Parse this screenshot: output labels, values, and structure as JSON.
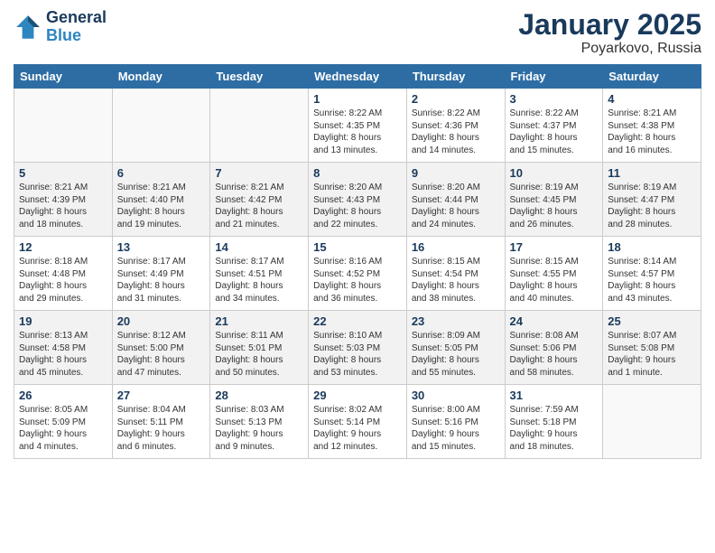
{
  "header": {
    "logo_line1": "General",
    "logo_line2": "Blue",
    "month_title": "January 2025",
    "location": "Poyarkovo, Russia"
  },
  "weekdays": [
    "Sunday",
    "Monday",
    "Tuesday",
    "Wednesday",
    "Thursday",
    "Friday",
    "Saturday"
  ],
  "weeks": [
    [
      {
        "day": "",
        "info": ""
      },
      {
        "day": "",
        "info": ""
      },
      {
        "day": "",
        "info": ""
      },
      {
        "day": "1",
        "info": "Sunrise: 8:22 AM\nSunset: 4:35 PM\nDaylight: 8 hours\nand 13 minutes."
      },
      {
        "day": "2",
        "info": "Sunrise: 8:22 AM\nSunset: 4:36 PM\nDaylight: 8 hours\nand 14 minutes."
      },
      {
        "day": "3",
        "info": "Sunrise: 8:22 AM\nSunset: 4:37 PM\nDaylight: 8 hours\nand 15 minutes."
      },
      {
        "day": "4",
        "info": "Sunrise: 8:21 AM\nSunset: 4:38 PM\nDaylight: 8 hours\nand 16 minutes."
      }
    ],
    [
      {
        "day": "5",
        "info": "Sunrise: 8:21 AM\nSunset: 4:39 PM\nDaylight: 8 hours\nand 18 minutes."
      },
      {
        "day": "6",
        "info": "Sunrise: 8:21 AM\nSunset: 4:40 PM\nDaylight: 8 hours\nand 19 minutes."
      },
      {
        "day": "7",
        "info": "Sunrise: 8:21 AM\nSunset: 4:42 PM\nDaylight: 8 hours\nand 21 minutes."
      },
      {
        "day": "8",
        "info": "Sunrise: 8:20 AM\nSunset: 4:43 PM\nDaylight: 8 hours\nand 22 minutes."
      },
      {
        "day": "9",
        "info": "Sunrise: 8:20 AM\nSunset: 4:44 PM\nDaylight: 8 hours\nand 24 minutes."
      },
      {
        "day": "10",
        "info": "Sunrise: 8:19 AM\nSunset: 4:45 PM\nDaylight: 8 hours\nand 26 minutes."
      },
      {
        "day": "11",
        "info": "Sunrise: 8:19 AM\nSunset: 4:47 PM\nDaylight: 8 hours\nand 28 minutes."
      }
    ],
    [
      {
        "day": "12",
        "info": "Sunrise: 8:18 AM\nSunset: 4:48 PM\nDaylight: 8 hours\nand 29 minutes."
      },
      {
        "day": "13",
        "info": "Sunrise: 8:17 AM\nSunset: 4:49 PM\nDaylight: 8 hours\nand 31 minutes."
      },
      {
        "day": "14",
        "info": "Sunrise: 8:17 AM\nSunset: 4:51 PM\nDaylight: 8 hours\nand 34 minutes."
      },
      {
        "day": "15",
        "info": "Sunrise: 8:16 AM\nSunset: 4:52 PM\nDaylight: 8 hours\nand 36 minutes."
      },
      {
        "day": "16",
        "info": "Sunrise: 8:15 AM\nSunset: 4:54 PM\nDaylight: 8 hours\nand 38 minutes."
      },
      {
        "day": "17",
        "info": "Sunrise: 8:15 AM\nSunset: 4:55 PM\nDaylight: 8 hours\nand 40 minutes."
      },
      {
        "day": "18",
        "info": "Sunrise: 8:14 AM\nSunset: 4:57 PM\nDaylight: 8 hours\nand 43 minutes."
      }
    ],
    [
      {
        "day": "19",
        "info": "Sunrise: 8:13 AM\nSunset: 4:58 PM\nDaylight: 8 hours\nand 45 minutes."
      },
      {
        "day": "20",
        "info": "Sunrise: 8:12 AM\nSunset: 5:00 PM\nDaylight: 8 hours\nand 47 minutes."
      },
      {
        "day": "21",
        "info": "Sunrise: 8:11 AM\nSunset: 5:01 PM\nDaylight: 8 hours\nand 50 minutes."
      },
      {
        "day": "22",
        "info": "Sunrise: 8:10 AM\nSunset: 5:03 PM\nDaylight: 8 hours\nand 53 minutes."
      },
      {
        "day": "23",
        "info": "Sunrise: 8:09 AM\nSunset: 5:05 PM\nDaylight: 8 hours\nand 55 minutes."
      },
      {
        "day": "24",
        "info": "Sunrise: 8:08 AM\nSunset: 5:06 PM\nDaylight: 8 hours\nand 58 minutes."
      },
      {
        "day": "25",
        "info": "Sunrise: 8:07 AM\nSunset: 5:08 PM\nDaylight: 9 hours\nand 1 minute."
      }
    ],
    [
      {
        "day": "26",
        "info": "Sunrise: 8:05 AM\nSunset: 5:09 PM\nDaylight: 9 hours\nand 4 minutes."
      },
      {
        "day": "27",
        "info": "Sunrise: 8:04 AM\nSunset: 5:11 PM\nDaylight: 9 hours\nand 6 minutes."
      },
      {
        "day": "28",
        "info": "Sunrise: 8:03 AM\nSunset: 5:13 PM\nDaylight: 9 hours\nand 9 minutes."
      },
      {
        "day": "29",
        "info": "Sunrise: 8:02 AM\nSunset: 5:14 PM\nDaylight: 9 hours\nand 12 minutes."
      },
      {
        "day": "30",
        "info": "Sunrise: 8:00 AM\nSunset: 5:16 PM\nDaylight: 9 hours\nand 15 minutes."
      },
      {
        "day": "31",
        "info": "Sunrise: 7:59 AM\nSunset: 5:18 PM\nDaylight: 9 hours\nand 18 minutes."
      },
      {
        "day": "",
        "info": ""
      }
    ]
  ]
}
